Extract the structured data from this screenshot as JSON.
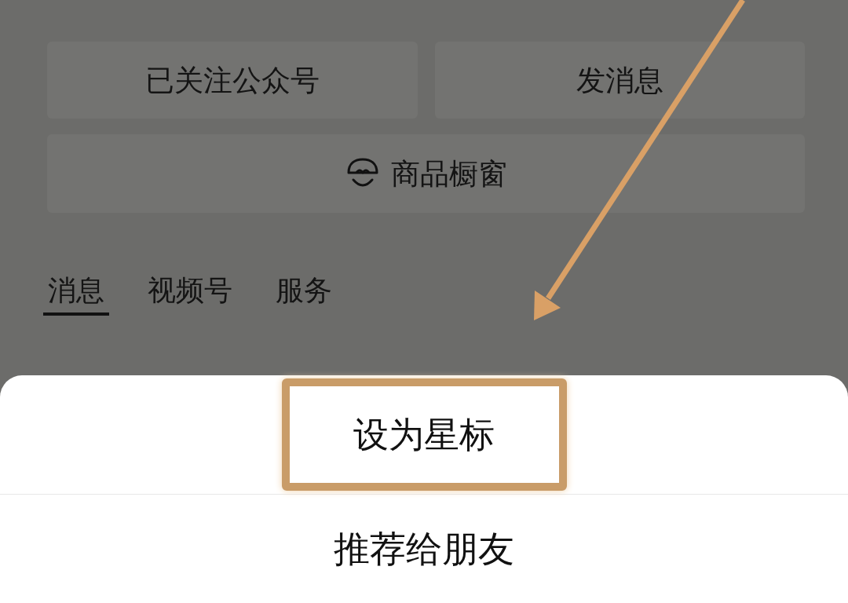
{
  "action_buttons": [
    {
      "label": "已关注公众号"
    },
    {
      "label": "发消息"
    }
  ],
  "shop_button": {
    "label": "商品橱窗"
  },
  "tabs": [
    {
      "label": "消息",
      "selected": true
    },
    {
      "label": "视频号",
      "selected": false
    },
    {
      "label": "服务",
      "selected": false
    }
  ],
  "action_sheet": {
    "items": [
      {
        "label": "设为星标",
        "highlighted": true
      },
      {
        "label": "推荐给朋友",
        "highlighted": false
      }
    ]
  }
}
